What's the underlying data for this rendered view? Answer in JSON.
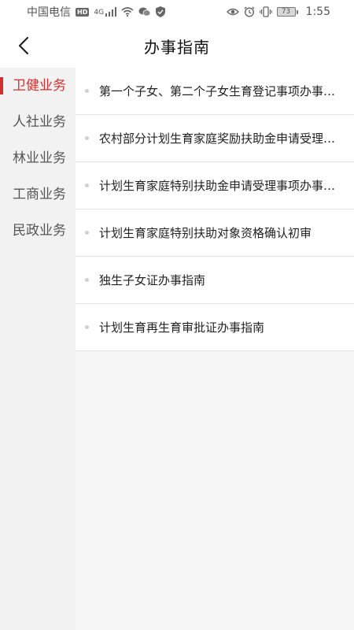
{
  "status_bar": {
    "carrier": "中国电信",
    "hd": "HD",
    "network": "4G",
    "battery": "73",
    "time": "1:55",
    "icons": [
      "hd-icon",
      "signal-icon",
      "wifi-icon",
      "wechat-icon",
      "shield-icon",
      "eye-icon",
      "alarm-icon",
      "vibrate-icon",
      "battery-icon"
    ]
  },
  "header": {
    "title": "办事指南",
    "back_icon": "chevron-left-icon"
  },
  "sidebar": {
    "items": [
      {
        "label": "卫健业务",
        "active": true
      },
      {
        "label": "人社业务",
        "active": false
      },
      {
        "label": "林业业务",
        "active": false
      },
      {
        "label": "工商业务",
        "active": false
      },
      {
        "label": "民政业务",
        "active": false
      }
    ]
  },
  "colors": {
    "accent": "#d62e2e",
    "sidebar_bg": "#f2f2f2",
    "list_bg": "#f7f7f7",
    "divider": "#e2e2e2"
  },
  "list": {
    "items": [
      {
        "title": "第一个子女、第二个子女生育登记事项办事指南"
      },
      {
        "title": "农村部分计划生育家庭奖励扶助金申请受理事项办事指南"
      },
      {
        "title": "计划生育家庭特别扶助金申请受理事项办事指南"
      },
      {
        "title": "计划生育家庭特别扶助对象资格确认初审"
      },
      {
        "title": "独生子女证办事指南"
      },
      {
        "title": "计划生育再生育审批证办事指南"
      }
    ]
  }
}
